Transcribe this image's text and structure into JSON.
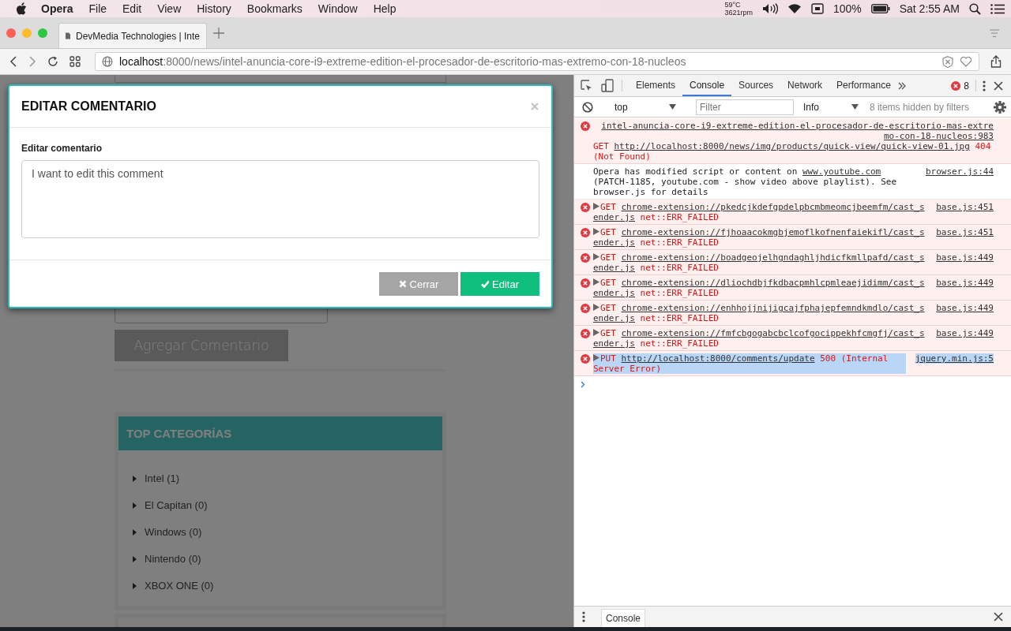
{
  "menu_bar": {
    "app": "Opera",
    "items": [
      "File",
      "Edit",
      "View",
      "History",
      "Bookmarks",
      "Window",
      "Help"
    ],
    "temperature": "59°C",
    "fan_speed": "3621rpm",
    "battery": "100%",
    "clock": "Sat 2:55 AM"
  },
  "browser": {
    "tab_title": "DevMedia Technologies | Inte",
    "address": {
      "host": "localhost",
      "path": ":8000/news/intel-anuncia-core-i9-extreme-edition-el-procesador-de-escritorio-mas-extremo-con-18-nucleos"
    }
  },
  "page": {
    "add_comment_button": "Agregar Comentario",
    "categories": {
      "title": "TOP CATEGORÍAS",
      "items": [
        "Intel (1)",
        "El Capitan (0)",
        "Windows (0)",
        "Nintendo (0)",
        "XBOX ONE (0)"
      ]
    }
  },
  "modal": {
    "title": "EDITAR COMENTARIO",
    "field_label": "Editar comentario",
    "value": "I want to edit this comment",
    "buttons": [
      {
        "kind": "cancel",
        "label": "Cerrar"
      },
      {
        "kind": "confirm",
        "label": "Editar"
      }
    ]
  },
  "devtools": {
    "tabs": [
      {
        "label": "Elements",
        "selected": false
      },
      {
        "label": "Console",
        "selected": true
      },
      {
        "label": "Sources",
        "selected": false
      },
      {
        "label": "Network",
        "selected": false
      },
      {
        "label": "Performance",
        "selected": false
      }
    ],
    "error_count": "8",
    "context": "top",
    "filter_placeholder": "Filter",
    "level": "Info",
    "hidden_note": "8 items hidden by filters",
    "messages": [
      {
        "kind": "error",
        "expandable": false,
        "selected": false,
        "source": "intel-anuncia-core-i9-extreme-edition-el-procesador-de-escritorio-mas-extremo-con-18-nucleos:983",
        "parts": [
          {
            "kind": "method",
            "text": "GET"
          },
          {
            "kind": "url",
            "text": "http://localhost:8000/news/img/products/quick-view/quick-view-01.jpg"
          },
          {
            "kind": "status",
            "text": "404 (Not Found)"
          }
        ]
      },
      {
        "kind": "info",
        "expandable": false,
        "selected": false,
        "source": "browser.js:44",
        "parts": [
          {
            "kind": "text",
            "text": "Opera has modified script or content on"
          },
          {
            "kind": "link",
            "text": "www.youtube.com"
          },
          {
            "kind": "text",
            "text": "(PATCH-1185, youtube.com - show video above playlist). See browser.js for details"
          }
        ]
      },
      {
        "kind": "error",
        "expandable": true,
        "selected": false,
        "source": "base.js:451",
        "parts": [
          {
            "kind": "method",
            "text": "GET"
          },
          {
            "kind": "url",
            "text": "chrome-extension://pkedcjkdefgpdelpbcmbmeomcjbeemfm/cast_sender.js"
          },
          {
            "kind": "status",
            "text": "net::ERR_FAILED"
          }
        ]
      },
      {
        "kind": "error",
        "expandable": true,
        "selected": false,
        "source": "base.js:451",
        "parts": [
          {
            "kind": "method",
            "text": "GET"
          },
          {
            "kind": "url",
            "text": "chrome-extension://fjhoaacokmgbjemoflkofnenfaiekifl/cast_sender.js"
          },
          {
            "kind": "status",
            "text": "net::ERR_FAILED"
          }
        ]
      },
      {
        "kind": "error",
        "expandable": true,
        "selected": false,
        "source": "base.js:449",
        "parts": [
          {
            "kind": "method",
            "text": "GET"
          },
          {
            "kind": "url",
            "text": "chrome-extension://boadgeojelhgndaghljhdicfkmllpafd/cast_sender.js"
          },
          {
            "kind": "status",
            "text": "net::ERR_FAILED"
          }
        ]
      },
      {
        "kind": "error",
        "expandable": true,
        "selected": false,
        "source": "base.js:449",
        "parts": [
          {
            "kind": "method",
            "text": "GET"
          },
          {
            "kind": "url",
            "text": "chrome-extension://dliochdbjfkdbacpmhlcpmleaejidimm/cast_sender.js"
          },
          {
            "kind": "status",
            "text": "net::ERR_FAILED"
          }
        ]
      },
      {
        "kind": "error",
        "expandable": true,
        "selected": false,
        "source": "base.js:449",
        "parts": [
          {
            "kind": "method",
            "text": "GET"
          },
          {
            "kind": "url",
            "text": "chrome-extension://enhhojjnijigcajfphajepfemndkmdlo/cast_sender.js"
          },
          {
            "kind": "status",
            "text": "net::ERR_FAILED"
          }
        ]
      },
      {
        "kind": "error",
        "expandable": true,
        "selected": false,
        "source": "base.js:449",
        "parts": [
          {
            "kind": "method",
            "text": "GET"
          },
          {
            "kind": "url",
            "text": "chrome-extension://fmfcbgogabcbclcofgocippekhfcmgfj/cast_sender.js"
          },
          {
            "kind": "status",
            "text": "net::ERR_FAILED"
          }
        ]
      },
      {
        "kind": "error",
        "expandable": true,
        "selected": true,
        "source": "jquery.min.js:5",
        "parts": [
          {
            "kind": "method",
            "text": "PUT"
          },
          {
            "kind": "url",
            "text": "http://localhost:8000/comments/update"
          },
          {
            "kind": "status",
            "text": "500 (Internal Server Error)"
          }
        ]
      }
    ],
    "drawer_tabs": [
      {
        "label": "Console",
        "selected": true
      }
    ]
  }
}
